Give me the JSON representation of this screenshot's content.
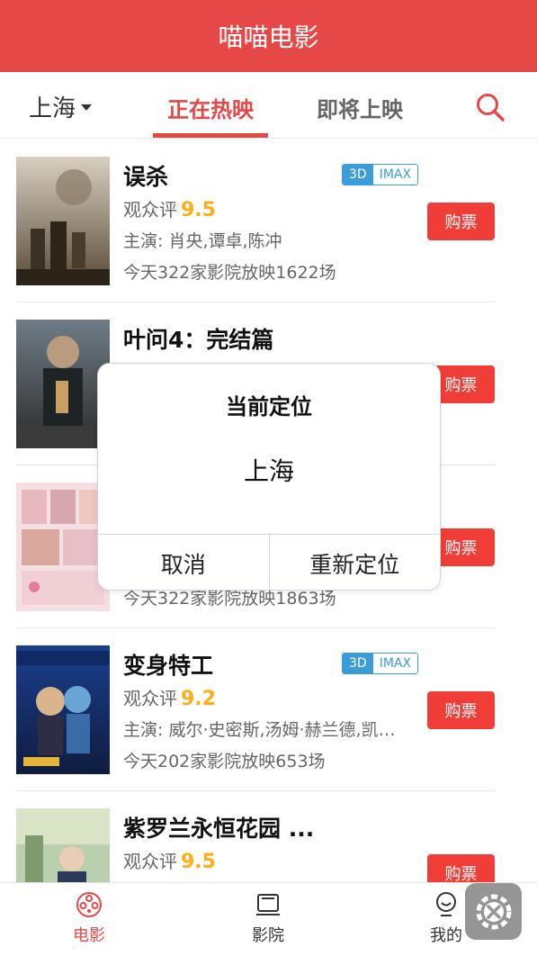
{
  "header": {
    "title": "喵喵电影"
  },
  "nav": {
    "city": "上海",
    "tabs": [
      {
        "label": "正在热映",
        "active": true
      },
      {
        "label": "即将上映",
        "active": false
      }
    ],
    "search_icon": "search-icon"
  },
  "movies": [
    {
      "title": "误杀",
      "badge_3d": "3D",
      "badge_imax": "IMAX",
      "score_label": "观众评",
      "score": "9.5",
      "actors": "主演: 肖央,谭卓,陈冲",
      "showings": "今天322家影院放映1622场",
      "buy_label": "购票"
    },
    {
      "title": "叶问4：完结篇",
      "buy_label": "购票"
    },
    {
      "showings": "今天322家影院放映1863场",
      "buy_label": "购票"
    },
    {
      "title": "变身特工",
      "badge_3d": "3D",
      "badge_imax": "IMAX",
      "score_label": "观众评",
      "score": "9.2",
      "actors": "主演: 威尔·史密斯,汤姆·赫兰德,凯伦·吉兰",
      "showings": "今天202家影院放映653场",
      "buy_label": "购票"
    },
    {
      "title": "紫罗兰永恒花园 ...",
      "score_label": "观众评",
      "score": "9.5",
      "buy_label": "购票"
    }
  ],
  "dialog": {
    "title": "当前定位",
    "city": "上海",
    "cancel_label": "取消",
    "relocate_label": "重新定位"
  },
  "tabbar": {
    "items": [
      {
        "label": "电影",
        "icon": "film-reel-icon",
        "active": true
      },
      {
        "label": "影院",
        "icon": "cinema-screen-icon",
        "active": false
      },
      {
        "label": "我的",
        "icon": "user-icon",
        "active": false
      }
    ]
  },
  "colors": {
    "brand": "#e54847",
    "buy": "#f03d37",
    "score": "#fbae17",
    "badge": "#3c9cd8"
  }
}
